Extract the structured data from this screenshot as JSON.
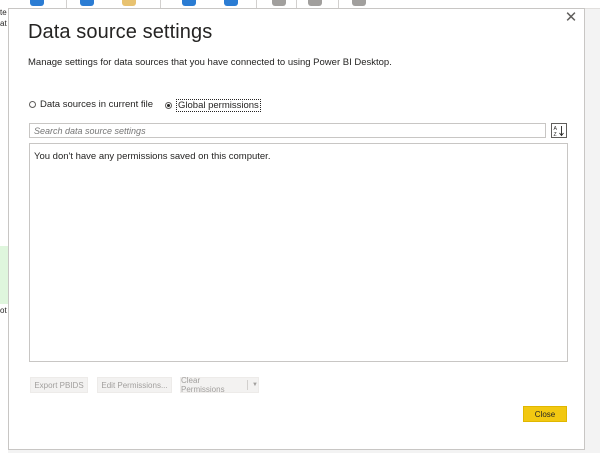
{
  "background": {
    "left_fragments": [
      "te",
      "at",
      "ot"
    ]
  },
  "dialog": {
    "title": "Data source settings",
    "subtitle": "Manage settings for data sources that you have connected to using Power BI Desktop.",
    "close_glyph": "✕",
    "radios": [
      {
        "label": "Data sources in current file",
        "checked": false
      },
      {
        "label": "Global permissions",
        "checked": true
      }
    ],
    "search": {
      "placeholder": "Search data source settings",
      "value": ""
    },
    "sort_icon": "sort-az-icon",
    "empty_message": "You don't have any permissions saved on this computer.",
    "buttons": {
      "export": "Export PBIDS",
      "edit": "Edit Permissions...",
      "clear": "Clear Permissions",
      "close": "Close"
    }
  },
  "colors": {
    "accent": "#f2c811",
    "disabled_text": "#a19f9d"
  }
}
